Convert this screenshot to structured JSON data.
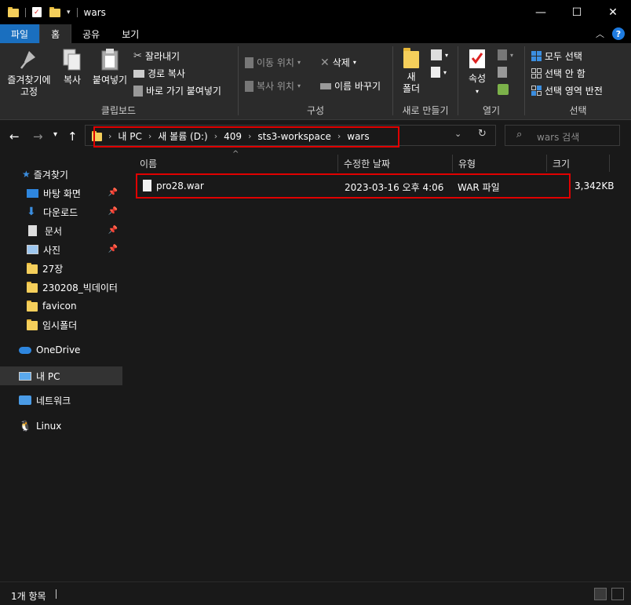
{
  "window": {
    "title": "wars",
    "minimize": "—",
    "maximize": "☐",
    "close": "✕"
  },
  "tabs": [
    {
      "label": "파일"
    },
    {
      "label": "홈"
    },
    {
      "label": "공유"
    },
    {
      "label": "보기"
    }
  ],
  "ribbon": {
    "clipboard": {
      "label": "클립보드",
      "pin": "즐겨찾기에",
      "pin2": "고정",
      "copy": "복사",
      "paste": "붙여넣기",
      "cut": "잘라내기",
      "copy_path": "경로 복사",
      "paste_shortcut": "바로 가기 붙여넣기"
    },
    "organize": {
      "label": "구성",
      "move_to": "이동 위치",
      "copy_to": "복사 위치",
      "delete": "삭제",
      "rename": "이름 바꾸기"
    },
    "new": {
      "label": "새로 만들기",
      "new_folder": "새",
      "new_folder2": "폴더"
    },
    "open": {
      "label": "열기",
      "properties": "속성"
    },
    "select": {
      "label": "선택",
      "select_all": "모두 선택",
      "select_none": "선택 안 함",
      "invert": "선택 영역 반전"
    }
  },
  "address": {
    "crumbs": [
      "내 PC",
      "새 볼륨 (D:)",
      "409",
      "sts3-workspace",
      "wars"
    ],
    "search_placeholder": "wars 검색"
  },
  "sidebar": {
    "items": [
      {
        "label": "즐겨찾기"
      },
      {
        "label": "바탕 화면"
      },
      {
        "label": "다운로드"
      },
      {
        "label": "문서"
      },
      {
        "label": "사진"
      },
      {
        "label": "27장"
      },
      {
        "label": "230208_빅데이터"
      },
      {
        "label": "favicon"
      },
      {
        "label": "임시폴더"
      },
      {
        "label": "OneDrive"
      },
      {
        "label": "내 PC"
      },
      {
        "label": "네트워크"
      },
      {
        "label": "Linux"
      }
    ]
  },
  "columns": {
    "name": "이름",
    "modified": "수정한 날짜",
    "type": "유형",
    "size": "크기"
  },
  "files": [
    {
      "name": "pro28.war",
      "modified": "2023-03-16 오후 4:06",
      "type": "WAR 파일",
      "size": "3,342KB"
    }
  ],
  "status": {
    "count": "1개 항목"
  }
}
